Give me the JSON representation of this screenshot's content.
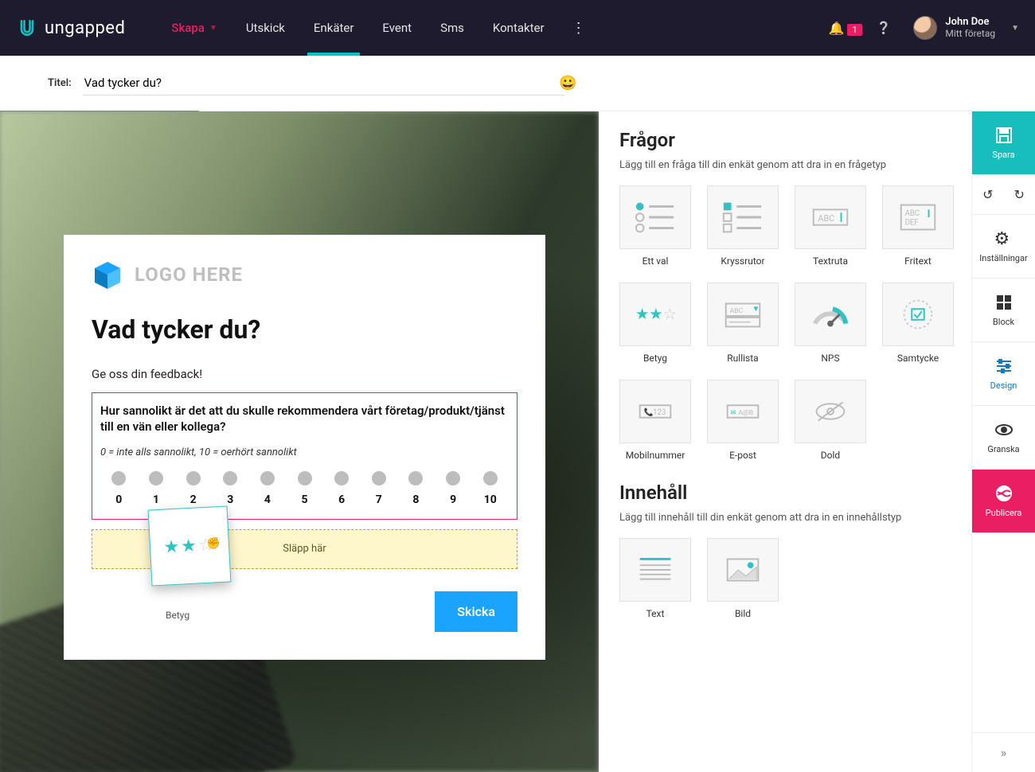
{
  "brand": "ungapped",
  "nav": {
    "create": "Skapa",
    "items": [
      "Utskick",
      "Enkäter",
      "Event",
      "Sms",
      "Kontakter"
    ],
    "active_index": 1,
    "notif_count": "1"
  },
  "user": {
    "name": "John Doe",
    "org": "Mitt företag"
  },
  "titlebar": {
    "label": "Titel:",
    "value": "Vad tycker du?"
  },
  "survey": {
    "logo_placeholder": "LOGO HERE",
    "heading": "Vad tycker du?",
    "subheading": "Ge oss din feedback!",
    "question": "Hur sannolikt är det att du skulle rekommendera vårt företag/produkt/tjänst till en vän eller kollega?",
    "scale_help": "0 = inte alls sannolikt, 10 = oerhört sannolikt",
    "nps_values": [
      "0",
      "1",
      "2",
      "3",
      "4",
      "5",
      "6",
      "7",
      "8",
      "9",
      "10"
    ],
    "drop_hint": "Släpp här",
    "drag_label": "Betyg",
    "send": "Skicka"
  },
  "palette": {
    "questions_h": "Frågor",
    "questions_sub": "Lägg till en fråga till din enkät genom att dra in en frågetyp",
    "question_tiles": [
      "Ett val",
      "Kryssrutor",
      "Textruta",
      "Fritext",
      "Betyg",
      "Rullista",
      "NPS",
      "Samtycke",
      "Mobilnummer",
      "E-post",
      "Dold"
    ],
    "content_h": "Innehåll",
    "content_sub": "Lägg till innehåll till din enkät genom att dra in en innehållstyp",
    "content_tiles": [
      "Text",
      "Bild"
    ]
  },
  "rail": {
    "save": "Spara",
    "settings": "Inställningar",
    "block": "Block",
    "design": "Design",
    "preview": "Granska",
    "publish": "Publicera"
  }
}
